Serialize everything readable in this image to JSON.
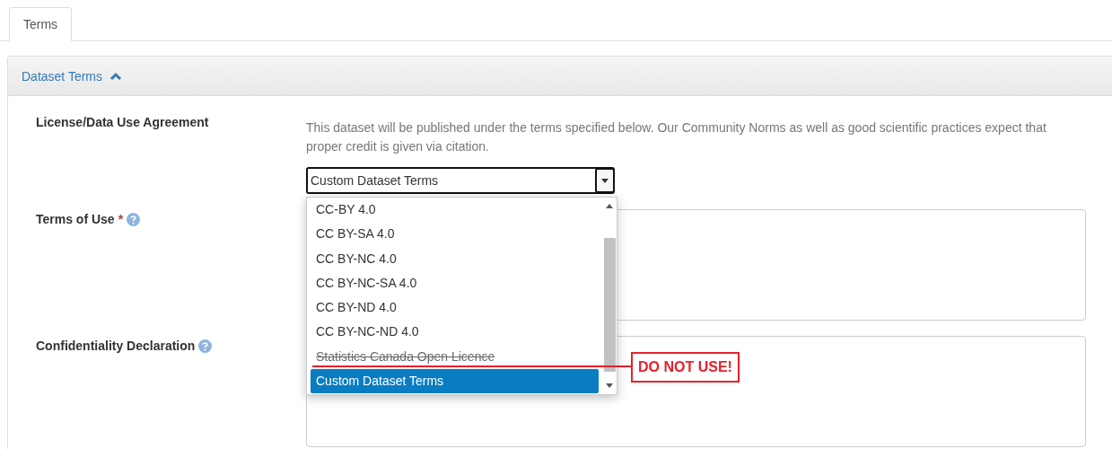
{
  "tabs": [
    {
      "label": "Terms",
      "selected": true
    }
  ],
  "panel": {
    "title": "Dataset Terms",
    "expanded": true
  },
  "fields": [
    {
      "kind": "select",
      "label": "License/Data Use Agreement",
      "description": "This dataset will be published under the terms specified below. Our Community Norms as well as good scientific practices expect that proper credit is given via citation.",
      "value": "Custom Dataset Terms",
      "options": [
        {
          "label": "CC-BY 4.0",
          "selected": false,
          "struck": false
        },
        {
          "label": "CC BY-SA 4.0",
          "selected": false,
          "struck": false
        },
        {
          "label": "CC BY-NC 4.0",
          "selected": false,
          "struck": false
        },
        {
          "label": "CC BY-NC-SA 4.0",
          "selected": false,
          "struck": false
        },
        {
          "label": "CC BY-ND 4.0",
          "selected": false,
          "struck": false
        },
        {
          "label": "CC BY-NC-ND 4.0",
          "selected": false,
          "struck": false
        },
        {
          "label": "Statistics Canada Open Licence",
          "selected": false,
          "struck": true
        },
        {
          "label": "Custom Dataset Terms",
          "selected": true,
          "struck": false
        }
      ],
      "annotation": "DO NOT USE!"
    },
    {
      "kind": "textarea",
      "label": "Terms of Use",
      "required_mark": "*",
      "help": true
    },
    {
      "kind": "textarea",
      "label": "Confidentiality Declaration",
      "help": true
    }
  ]
}
